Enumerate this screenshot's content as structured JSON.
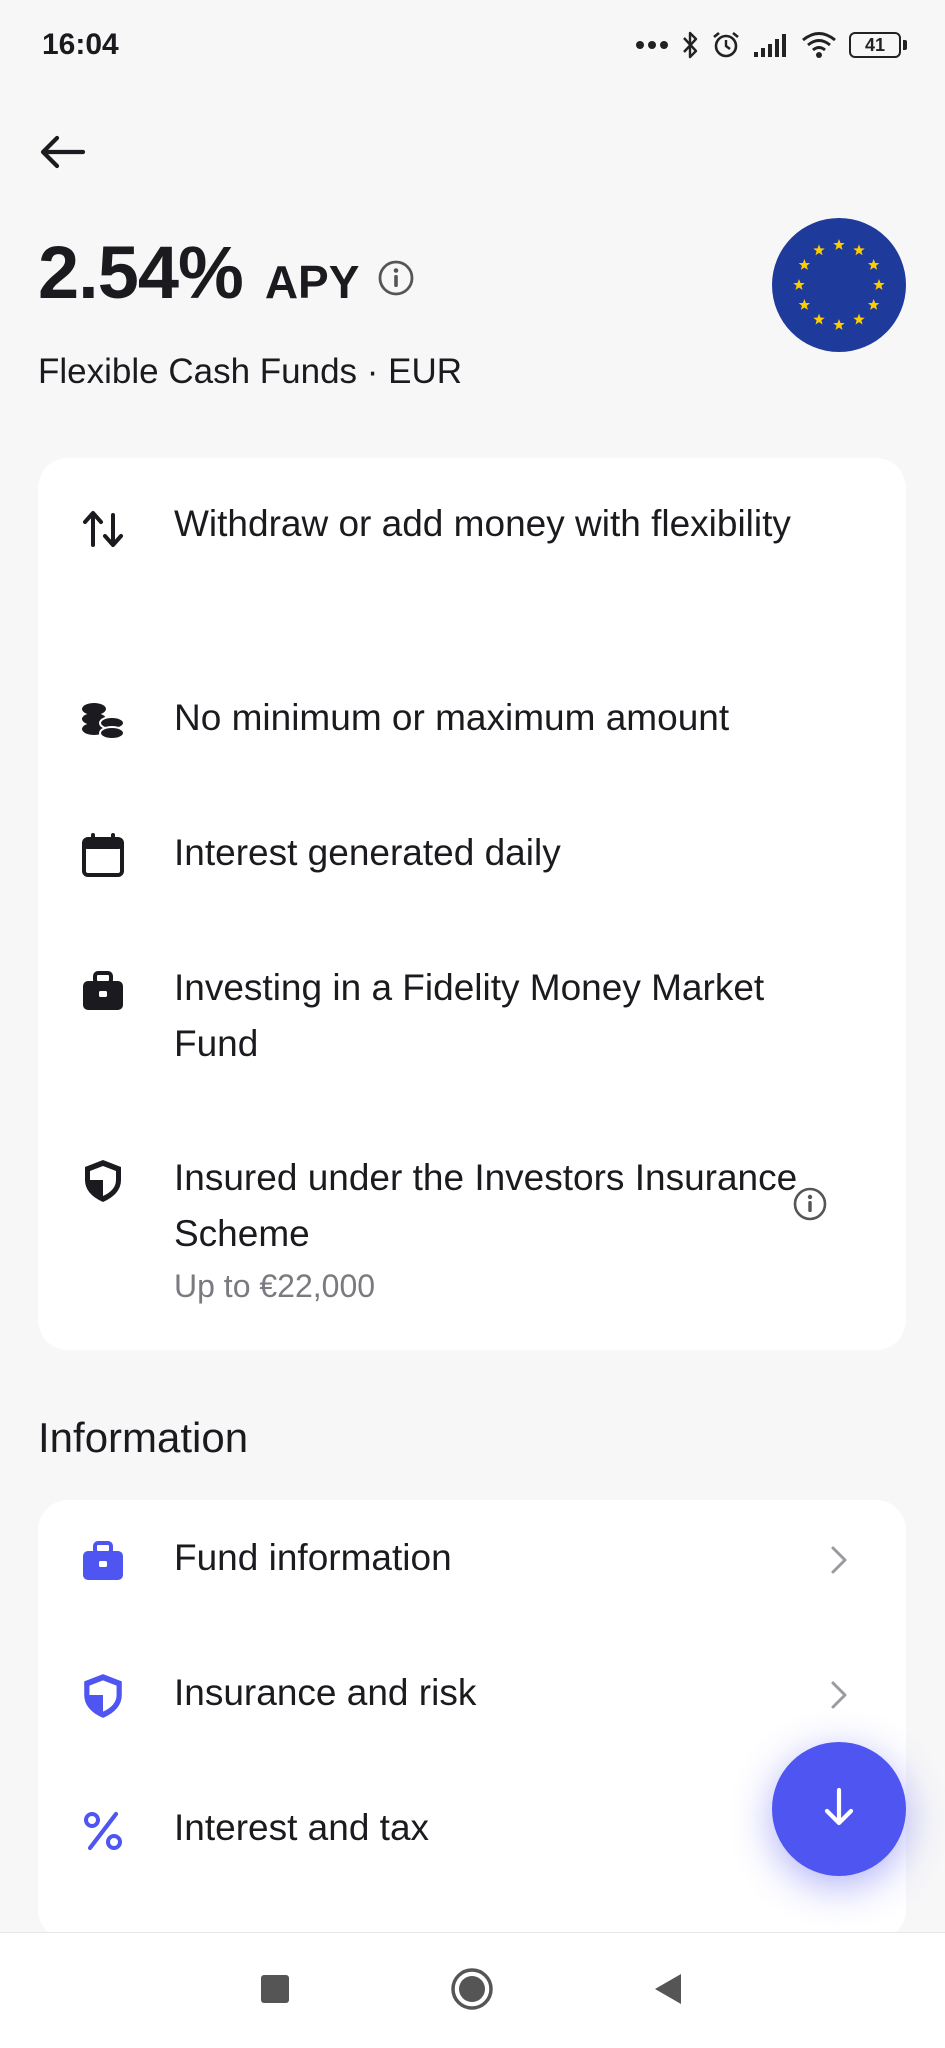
{
  "status_bar": {
    "time": "16:04",
    "battery": "41",
    "icons": [
      "more-dots-icon",
      "bluetooth-icon",
      "alarm-icon",
      "signal-icon",
      "wifi-icon",
      "battery-icon"
    ]
  },
  "header": {
    "apy_value": "2.54%",
    "apy_label": "APY",
    "subtitle": "Flexible Cash Funds · EUR",
    "flag_icon": "eu-flag-icon"
  },
  "features": [
    {
      "icon": "arrows-up-down-icon",
      "text": "Withdraw or add money with flexibility"
    },
    {
      "icon": "coins-icon",
      "text": "No minimum or maximum amount"
    },
    {
      "icon": "calendar-icon",
      "text": "Interest generated daily"
    },
    {
      "icon": "briefcase-icon",
      "text": "Investing in a Fidelity Money Market Fund"
    },
    {
      "icon": "shield-icon",
      "text": "Insured under the Investors Insurance Scheme",
      "subtext": "Up to €22,000",
      "info_icon": "info-icon"
    }
  ],
  "information": {
    "title": "Information",
    "items": [
      {
        "icon": "briefcase-icon",
        "label": "Fund information"
      },
      {
        "icon": "shield-icon",
        "label": "Insurance and risk"
      },
      {
        "icon": "percent-icon",
        "label": "Interest and tax"
      }
    ]
  },
  "fab": {
    "icon": "arrow-down-icon"
  },
  "colors": {
    "accent": "#4f55f0",
    "background": "#f7f7f8",
    "card": "#ffffff",
    "text": "#1b1b1f",
    "muted": "#7a7a80",
    "flag_blue": "#1e3a9b",
    "flag_star": "#ffcc00"
  }
}
